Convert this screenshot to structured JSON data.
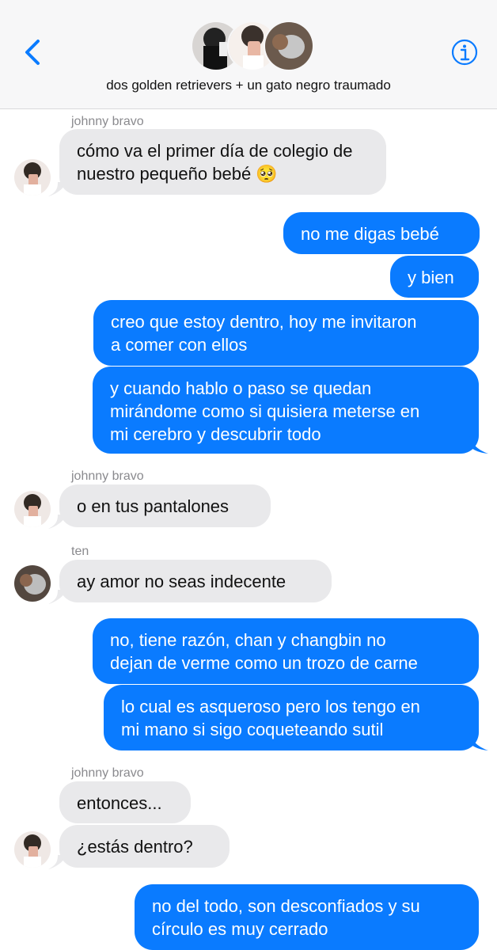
{
  "header": {
    "group_name": "dos golden retrievers + un gato negro traumado",
    "back_icon": "chevron-left-icon",
    "info_icon": "info-icon",
    "accent": "#0a7bff"
  },
  "messages": [
    {
      "sender": "johnny bravo"
    },
    {
      "text_lines": [
        "cómo va el primer día de colegio de",
        "nuestro pequeño bebé 🥺"
      ]
    },
    {
      "text": "no me digas bebé"
    },
    {
      "text": "y bien"
    },
    {
      "text_lines": [
        "creo que estoy dentro, hoy me invitaron",
        "a comer con ellos"
      ]
    },
    {
      "text_lines": [
        "y cuando hablo o paso se quedan",
        "mirándome como si quisiera meterse en",
        "mi cerebro y descubrir todo"
      ]
    },
    {
      "sender": "johnny bravo"
    },
    {
      "text": "o en tus pantalones"
    },
    {
      "sender": "ten"
    },
    {
      "text": "ay amor no seas indecente"
    },
    {
      "text_lines": [
        "no, tiene razón, chan y changbin no",
        "dejan de verme como un trozo de carne"
      ]
    },
    {
      "text_lines": [
        "lo cual es asqueroso pero los tengo en",
        "mi mano si sigo coqueteando sutil"
      ]
    },
    {
      "sender": "johnny bravo"
    },
    {
      "text": "entonces..."
    },
    {
      "text": "¿estás dentro?"
    },
    {
      "text_lines": [
        "no del todo, son desconfiados y su",
        "círculo es muy cerrado"
      ]
    }
  ]
}
